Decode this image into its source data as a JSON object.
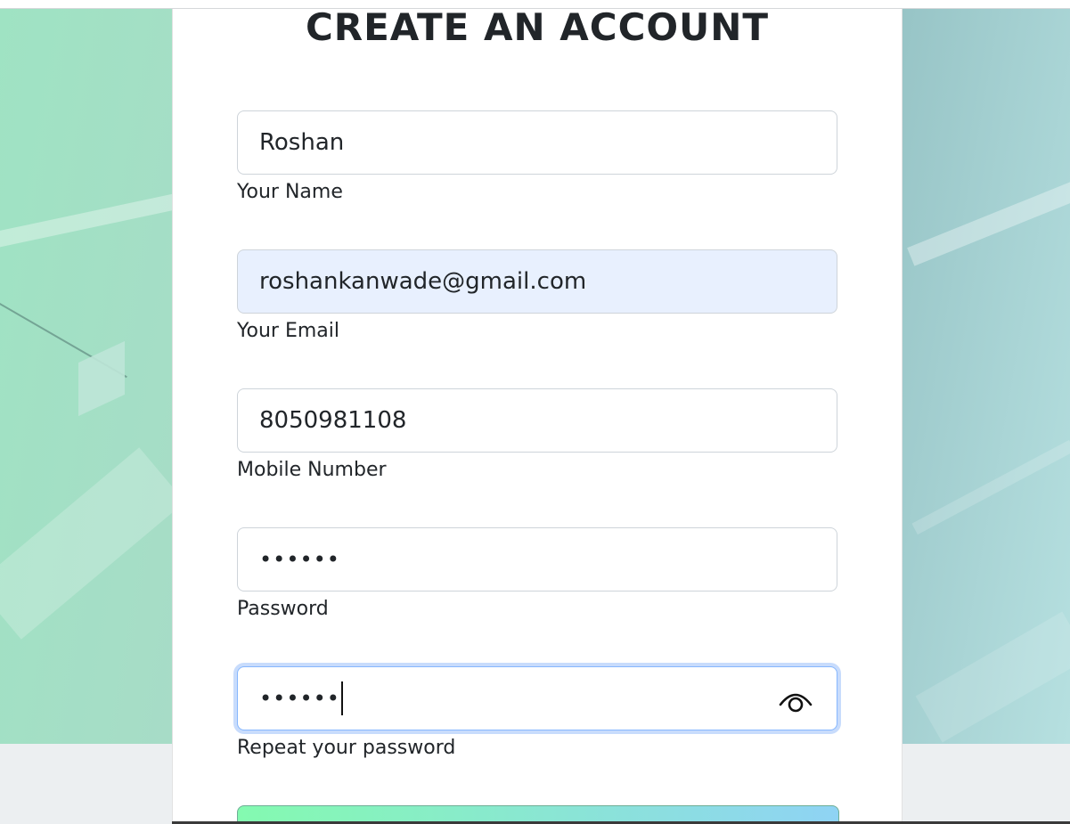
{
  "form": {
    "title": "CREATE AN ACCOUNT",
    "name": {
      "value": "Roshan",
      "label": "Your Name"
    },
    "email": {
      "value": "roshankanwade@gmail.com",
      "label": "Your Email"
    },
    "mobile": {
      "value": "8050981108",
      "label": "Mobile Number"
    },
    "password": {
      "value": "••••••",
      "label": "Password"
    },
    "repeat_password": {
      "value": "••••••",
      "label": "Repeat your password",
      "icon": "eye-icon"
    }
  },
  "colors": {
    "button_gradient_start": "#84fab0",
    "button_gradient_end": "#8fd3f4",
    "autofill_bg": "#e8f0fe",
    "focus_ring": "#86b7fe"
  }
}
